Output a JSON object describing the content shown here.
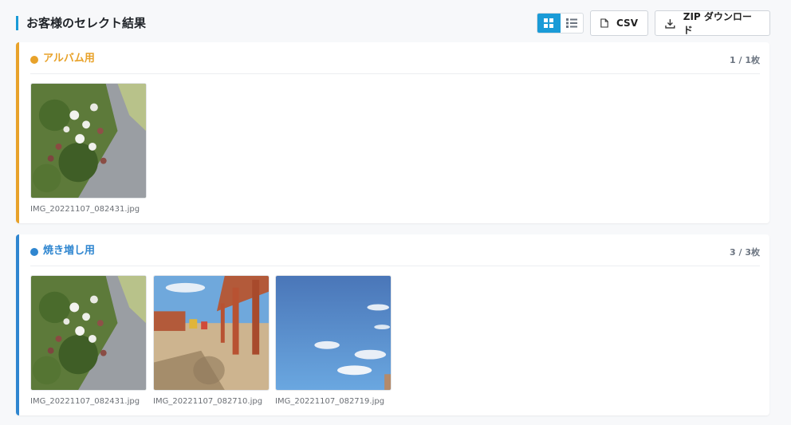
{
  "header": {
    "title": "お客様のセレクト結果",
    "csv_label": "CSV",
    "zip_label": "ZIP ダウンロード"
  },
  "colors": {
    "accent": "#1a9bd7",
    "album": "#e8a22a",
    "reprint": "#2f86d0"
  },
  "sections": [
    {
      "title": "アルバム用",
      "count": "1 / 1枚",
      "photos": [
        {
          "filename": "IMG_20221107_082431.jpg",
          "subject": "white flowers by gravel path"
        }
      ]
    },
    {
      "title": "焼き増し用",
      "count": "3 / 3枚",
      "photos": [
        {
          "filename": "IMG_20221107_082431.jpg",
          "subject": "white flowers by gravel path"
        },
        {
          "filename": "IMG_20221107_082710.jpg",
          "subject": "playground pergola"
        },
        {
          "filename": "IMG_20221107_082719.jpg",
          "subject": "blue sky with clouds"
        }
      ]
    }
  ]
}
